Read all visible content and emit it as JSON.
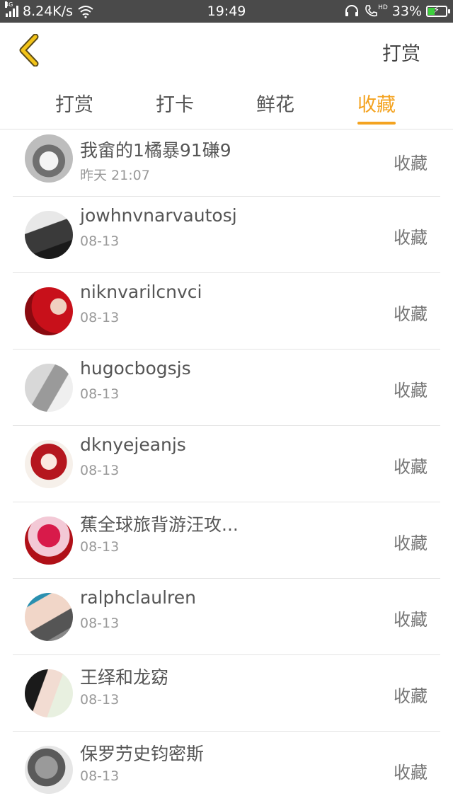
{
  "status_bar": {
    "network": "4G",
    "speed": "8.24K/s",
    "time": "19:49",
    "hd": "HD",
    "battery": "33%"
  },
  "header": {
    "back_icon": "chevron-left-icon",
    "action_label": "打赏",
    "accent_color": "#f4a320"
  },
  "tabs": [
    {
      "label": "打赏",
      "active": false
    },
    {
      "label": "打卡",
      "active": false
    },
    {
      "label": "鲜花",
      "active": false
    },
    {
      "label": "收藏",
      "active": true
    }
  ],
  "items": [
    {
      "name": "我畲的1橘暴91磏9",
      "time": "昨天 21:07",
      "action": "收藏"
    },
    {
      "name": "jowhnvnarvautosj",
      "time": "08-13",
      "action": "收藏"
    },
    {
      "name": "niknvarilcnvci",
      "time": "08-13",
      "action": "收藏"
    },
    {
      "name": "hugocbogsjs",
      "time": "08-13",
      "action": "收藏"
    },
    {
      "name": "dknyejeanjs",
      "time": "08-13",
      "action": "收藏"
    },
    {
      "name": "蕉全球旅背游汪攻...",
      "time": "08-13",
      "action": "收藏"
    },
    {
      "name": "ralphclaulren",
      "time": "08-13",
      "action": "收藏"
    },
    {
      "name": "王绎和龙窈",
      "time": "08-13",
      "action": "收藏"
    },
    {
      "name": "保罗芀史钧密斯",
      "time": "08-13",
      "action": "收藏"
    }
  ]
}
